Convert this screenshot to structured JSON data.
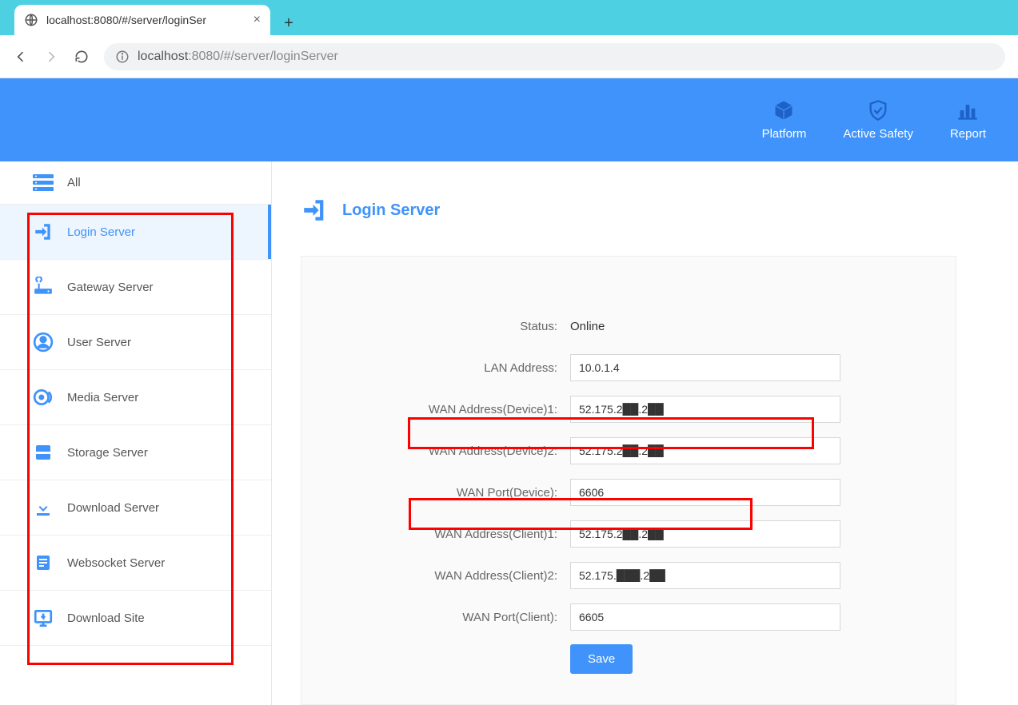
{
  "browser": {
    "tab_title": "localhost:8080/#/server/loginSer",
    "url_host": "localhost",
    "url_port_path": ":8080/#/server/loginServer"
  },
  "header": {
    "items": [
      {
        "label": "Platform"
      },
      {
        "label": "Active Safety"
      },
      {
        "label": "Report"
      }
    ]
  },
  "sidebar": {
    "items": [
      {
        "label": "All"
      },
      {
        "label": "Login Server"
      },
      {
        "label": "Gateway Server"
      },
      {
        "label": "User Server"
      },
      {
        "label": "Media Server"
      },
      {
        "label": "Storage Server"
      },
      {
        "label": "Download Server"
      },
      {
        "label": "Websocket Server"
      },
      {
        "label": "Download Site"
      }
    ]
  },
  "page": {
    "title": "Login Server"
  },
  "form": {
    "labels": {
      "status": "Status:",
      "lan_address": "LAN Address:",
      "wan_device1": "WAN Address(Device)1:",
      "wan_device2": "WAN Address(Device)2:",
      "wan_port_device": "WAN Port(Device):",
      "wan_client1": "WAN Address(Client)1:",
      "wan_client2": "WAN Address(Client)2:",
      "wan_port_client": "WAN Port(Client):"
    },
    "values": {
      "status": "Online",
      "lan_address": "10.0.1.4",
      "wan_device1": "52.175.2██.2██",
      "wan_device2": "52.175.2██.2██",
      "wan_port_device": "6606",
      "wan_client1": "52.175.2██.2██",
      "wan_client2": "52.175.███.2██",
      "wan_port_client": "6605"
    },
    "save_label": "Save"
  }
}
